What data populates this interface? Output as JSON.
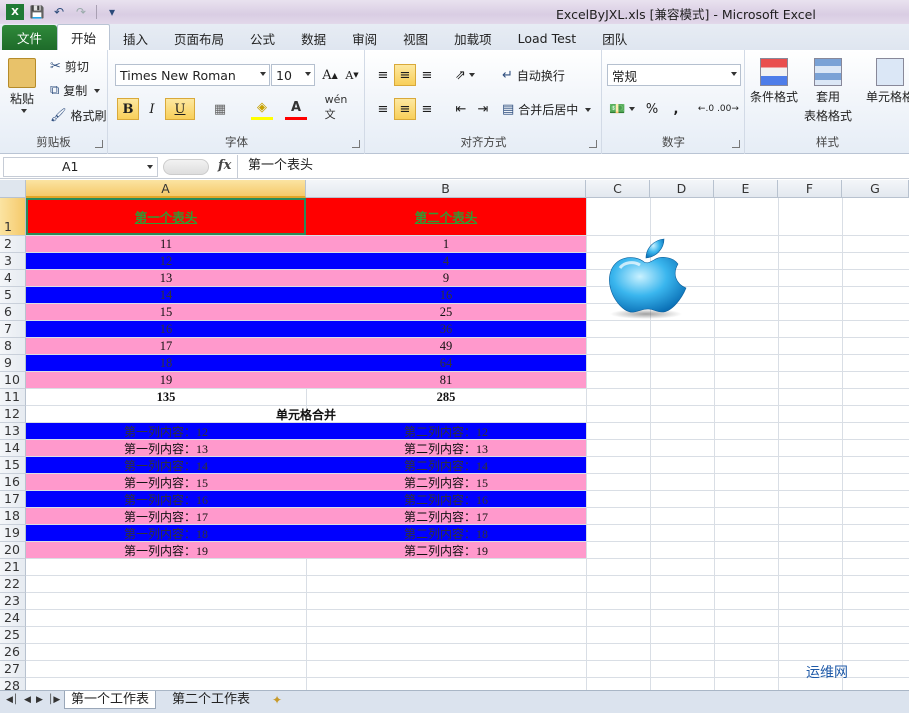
{
  "window": {
    "title": "ExcelByJXL.xls  [兼容模式]  -  Microsoft Excel"
  },
  "ribbon_tabs": [
    "文件",
    "开始",
    "插入",
    "页面布局",
    "公式",
    "数据",
    "审阅",
    "视图",
    "加载项",
    "Load Test",
    "团队"
  ],
  "clipboard": {
    "paste": "粘贴",
    "cut": "剪切",
    "copy": "复制",
    "format_painter": "格式刷",
    "label": "剪贴板"
  },
  "font": {
    "name": "Times New Roman",
    "size": "10",
    "bold": "B",
    "italic": "I",
    "underline": "U",
    "label": "字体"
  },
  "alignment": {
    "wrap": "自动换行",
    "merge": "合并后居中",
    "label": "对齐方式"
  },
  "number": {
    "format": "常规",
    "percent": "%",
    "comma": ",",
    "label": "数字"
  },
  "styles": {
    "conditional": "条件格式",
    "table1": "套用",
    "table2": "表格格式",
    "cell_styles": "单元格格",
    "label": "样式"
  },
  "formula_bar": {
    "name_box": "A1",
    "fx": "fx",
    "content": "第一个表头"
  },
  "columns": [
    "A",
    "B",
    "C",
    "D",
    "E",
    "F",
    "G"
  ],
  "rows": [
    "1",
    "2",
    "3",
    "4",
    "5",
    "6",
    "7",
    "8",
    "9",
    "10",
    "11",
    "12",
    "13",
    "14",
    "15",
    "16",
    "17",
    "18",
    "19",
    "20",
    "21",
    "22",
    "23",
    "24",
    "25",
    "26",
    "27",
    "28"
  ],
  "sheet": {
    "header_a": "第一个表头",
    "header_b": "第二个表头",
    "values_a": [
      "11",
      "12",
      "13",
      "14",
      "15",
      "16",
      "17",
      "18",
      "19"
    ],
    "values_b": [
      "1",
      "4",
      "9",
      "16",
      "25",
      "36",
      "49",
      "64",
      "81"
    ],
    "total_a": "135",
    "total_b": "285",
    "merged_label": "单元格合并",
    "content_a": [
      "第一列内容：12",
      "第一列内容：13",
      "第一列内容：14",
      "第一列内容：15",
      "第一列内容：16",
      "第一列内容：17",
      "第一列内容：18",
      "第一列内容：19"
    ],
    "content_b": [
      "第二列内容：12",
      "第二列内容：13",
      "第二列内容：14",
      "第二列内容：15",
      "第二列内容：16",
      "第二列内容：17",
      "第二列内容：18",
      "第二列内容：19"
    ]
  },
  "sheet_tabs": [
    "第一个工作表",
    "第二个工作表"
  ],
  "watermark": "运维网",
  "colors": {
    "header_fill": "#ff0000",
    "pink": "#ff99cc",
    "blue": "#0000ff",
    "header_text": "#339933"
  }
}
